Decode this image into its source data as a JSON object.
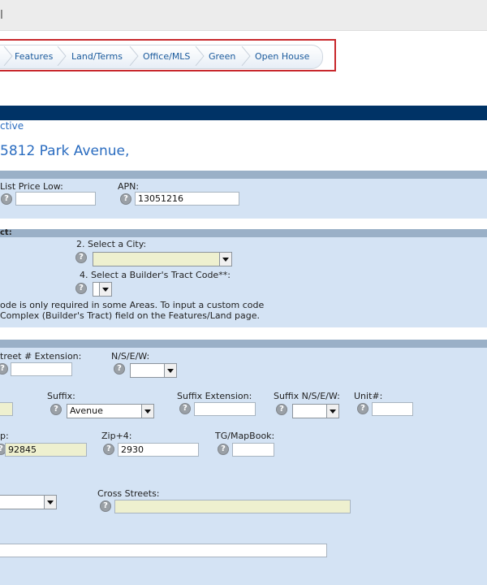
{
  "header": {
    "cut_text": "l"
  },
  "tabs": [
    "Features",
    "Land/Terms",
    "Office/MLS",
    "Green",
    "Open House"
  ],
  "listing": {
    "status": "ctive",
    "address": "5812 Park Avenue,"
  },
  "price_section": {
    "list_price_low_label": "List Price Low:",
    "list_price_low_value": "",
    "apn_label": "APN:",
    "apn_value": "13051216"
  },
  "tract_section": {
    "title": "ct:",
    "city_label": "2. Select a City:",
    "city_value": "",
    "tract_label": "4. Select a Builder's Tract Code**:",
    "tract_value": "",
    "note_line1": "ode is only required in some Areas.  To input a custom code",
    "note_line2": "Complex (Builder's Tract) field on the Features/Land page."
  },
  "address_section": {
    "street_ext_label": "treet # Extension:",
    "street_ext_value": "",
    "nsew_label": "N/S/E/W:",
    "nsew_value": "",
    "suffix_label": "Suffix:",
    "suffix_value": "Avenue",
    "suffix_ext_label": "Suffix Extension:",
    "suffix_ext_value": "",
    "suffix_nsew_label": "Suffix N/S/E/W:",
    "suffix_nsew_value": "",
    "unit_label": "Unit#:",
    "unit_value": "",
    "zip_label": "p:",
    "zip_value": "92845",
    "zip4_label": "Zip+4:",
    "zip4_value": "2930",
    "tg_label": "TG/MapBook:",
    "tg_value": "",
    "cross_streets_label": "Cross Streets:",
    "cross_streets_value": "",
    "area_select_value": "",
    "bottom_field_value": ""
  },
  "help_glyph": "?"
}
